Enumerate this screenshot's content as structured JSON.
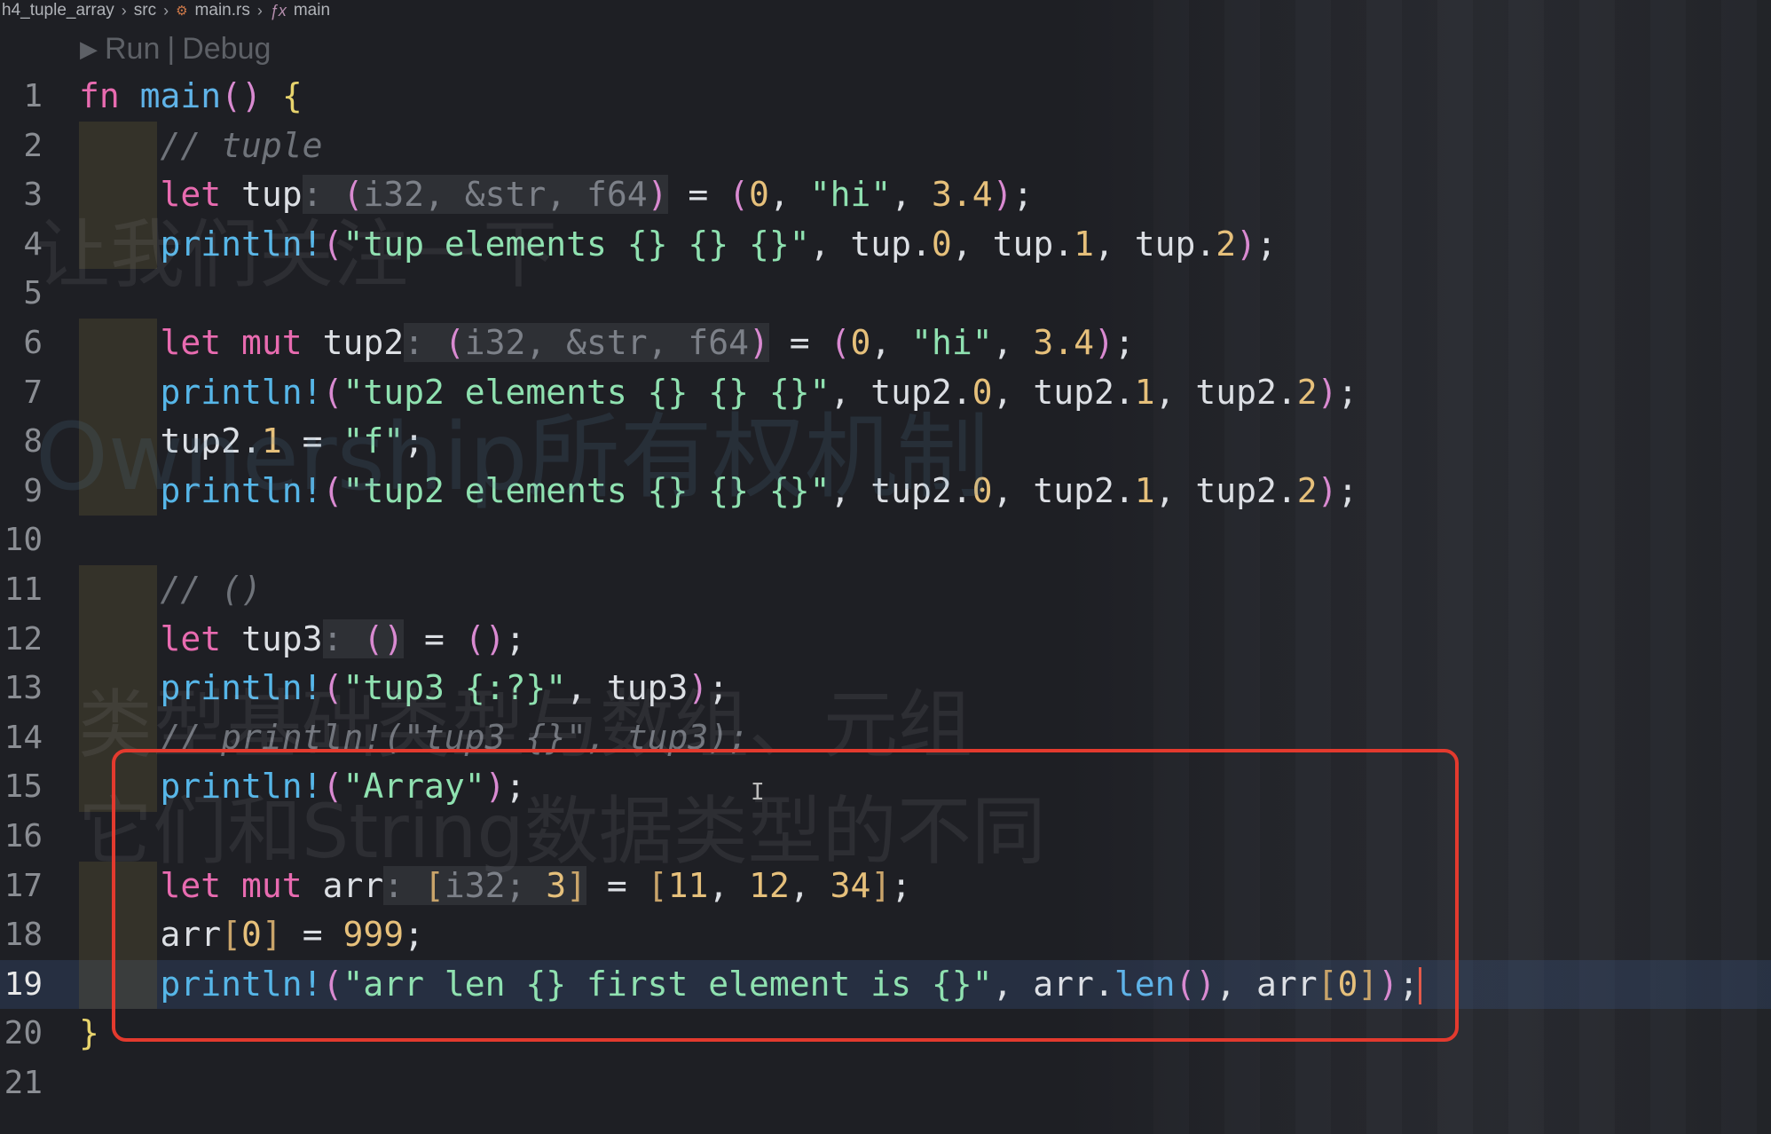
{
  "breadcrumb": {
    "folder": "h4_tuple_array",
    "src": "src",
    "file": "main.rs",
    "symbol": "main"
  },
  "codelens": {
    "run": "Run",
    "separator": "|",
    "debug": "Debug"
  },
  "editor": {
    "language": "rust",
    "current_line": 19,
    "lines": [
      {
        "n": "1",
        "text": "fn main() {"
      },
      {
        "n": "2",
        "text": "    // tuple"
      },
      {
        "n": "3",
        "text": "    let tup: (i32, &str, f64) = (0, \"hi\", 3.4);"
      },
      {
        "n": "4",
        "text": "    println!(\"tup elements {} {} {}\", tup.0, tup.1, tup.2);"
      },
      {
        "n": "5",
        "text": ""
      },
      {
        "n": "6",
        "text": "    let mut tup2: (i32, &str, f64) = (0, \"hi\", 3.4);"
      },
      {
        "n": "7",
        "text": "    println!(\"tup2 elements {} {} {}\", tup2.0, tup2.1, tup2.2);"
      },
      {
        "n": "8",
        "text": "    tup2.1 = \"f\";"
      },
      {
        "n": "9",
        "text": "    println!(\"tup2 elements {} {} {}\", tup2.0, tup2.1, tup2.2);"
      },
      {
        "n": "10",
        "text": ""
      },
      {
        "n": "11",
        "text": "    // ()"
      },
      {
        "n": "12",
        "text": "    let tup3: () = ();"
      },
      {
        "n": "13",
        "text": "    println!(\"tup3 {:?}\", tup3);"
      },
      {
        "n": "14",
        "text": "    // println!(\"tup3 {}\", tup3);"
      },
      {
        "n": "15",
        "text": "    println!(\"Array\");"
      },
      {
        "n": "16",
        "text": ""
      },
      {
        "n": "17",
        "text": "    let mut arr: [i32; 3] = [11, 12, 34];"
      },
      {
        "n": "18",
        "text": "    arr[0] = 999;"
      },
      {
        "n": "19",
        "text": "    println!(\"arr len {} first element is {}\", arr.len(), arr[0]);"
      },
      {
        "n": "20",
        "text": "}"
      },
      {
        "n": "21",
        "text": ""
      }
    ]
  },
  "watermarks": {
    "line1": "让我们关注一下",
    "line2": "Ownership所有权机制",
    "line3": "类型基础类型与数组、元组",
    "line4": "它们和String数据类型的不同"
  },
  "colors": {
    "background": "#1e1f24",
    "keyword": "#e86bb0",
    "string": "#8fe1b0",
    "number": "#e6c07b",
    "macro": "#56b6e8",
    "annotation_box": "#e33a2e"
  }
}
